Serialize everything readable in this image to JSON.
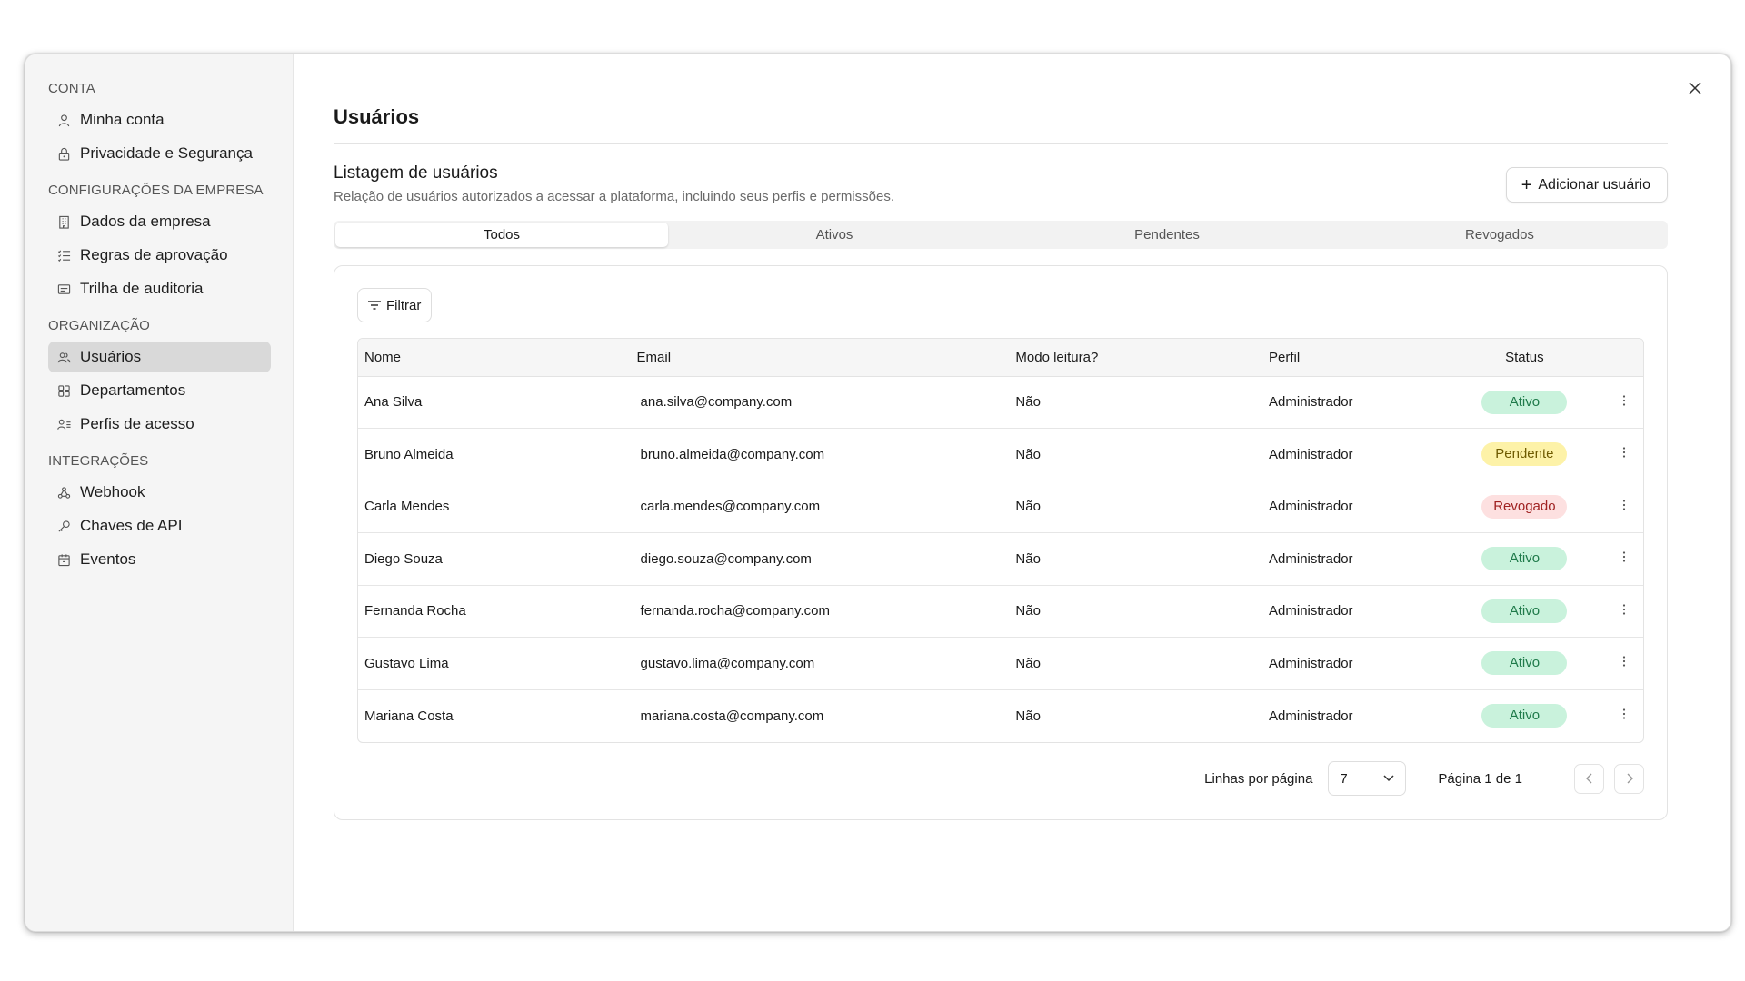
{
  "sidebar": {
    "sections": [
      {
        "heading": "CONTA",
        "items": [
          {
            "label": "Minha conta",
            "icon": "user-icon"
          },
          {
            "label": "Privacidade e Segurança",
            "icon": "lock-icon"
          }
        ]
      },
      {
        "heading": "CONFIGURAÇÕES DA EMPRESA",
        "items": [
          {
            "label": "Dados da empresa",
            "icon": "building-icon"
          },
          {
            "label": "Regras de aprovação",
            "icon": "list-check-icon"
          },
          {
            "label": "Trilha de auditoria",
            "icon": "audit-icon"
          }
        ]
      },
      {
        "heading": "ORGANIZAÇÃO",
        "items": [
          {
            "label": "Usuários",
            "icon": "users-icon",
            "active": true
          },
          {
            "label": "Departamentos",
            "icon": "grid-icon"
          },
          {
            "label": "Perfis de acesso",
            "icon": "user-list-icon"
          }
        ]
      },
      {
        "heading": "INTEGRAÇÕES",
        "items": [
          {
            "label": "Webhook",
            "icon": "webhook-icon"
          },
          {
            "label": "Chaves de API",
            "icon": "key-icon"
          },
          {
            "label": "Eventos",
            "icon": "calendar-icon"
          }
        ]
      }
    ]
  },
  "main": {
    "title": "Usuários",
    "listing_title": "Listagem de usuários",
    "listing_subtitle": "Relação de usuários autorizados a acessar a plataforma, incluindo seus perfis e permissões.",
    "add_button": "Adicionar usuário",
    "tabs": [
      "Todos",
      "Ativos",
      "Pendentes",
      "Revogados"
    ],
    "active_tab": "Todos",
    "filter_button": "Filtrar"
  },
  "table": {
    "columns": [
      "Nome",
      "Email",
      "Modo leitura?",
      "Perfil",
      "Status"
    ],
    "rows": [
      {
        "nome": "Ana Silva",
        "email": "ana.silva@company.com",
        "modo": "Não",
        "perfil": "Administrador",
        "status": "Ativo"
      },
      {
        "nome": "Bruno Almeida",
        "email": "bruno.almeida@company.com",
        "modo": "Não",
        "perfil": "Administrador",
        "status": "Pendente"
      },
      {
        "nome": "Carla Mendes",
        "email": "carla.mendes@company.com",
        "modo": "Não",
        "perfil": "Administrador",
        "status": "Revogado"
      },
      {
        "nome": "Diego Souza",
        "email": "diego.souza@company.com",
        "modo": "Não",
        "perfil": "Administrador",
        "status": "Ativo"
      },
      {
        "nome": "Fernanda Rocha",
        "email": "fernanda.rocha@company.com",
        "modo": "Não",
        "perfil": "Administrador",
        "status": "Ativo"
      },
      {
        "nome": "Gustavo Lima",
        "email": "gustavo.lima@company.com",
        "modo": "Não",
        "perfil": "Administrador",
        "status": "Ativo"
      },
      {
        "nome": "Mariana Costa",
        "email": "mariana.costa@company.com",
        "modo": "Não",
        "perfil": "Administrador",
        "status": "Ativo"
      }
    ]
  },
  "pagination": {
    "rows_label": "Linhas por página",
    "rows_value": "7",
    "page_info": "Página 1 de 1"
  },
  "colors": {
    "ativo_bg": "#c9f2dc",
    "pendente_bg": "#fdf2a8",
    "revogado_bg": "#fde0e0",
    "sidebar_bg": "#f5f5f5",
    "active_item_bg": "#d9d9d9"
  }
}
